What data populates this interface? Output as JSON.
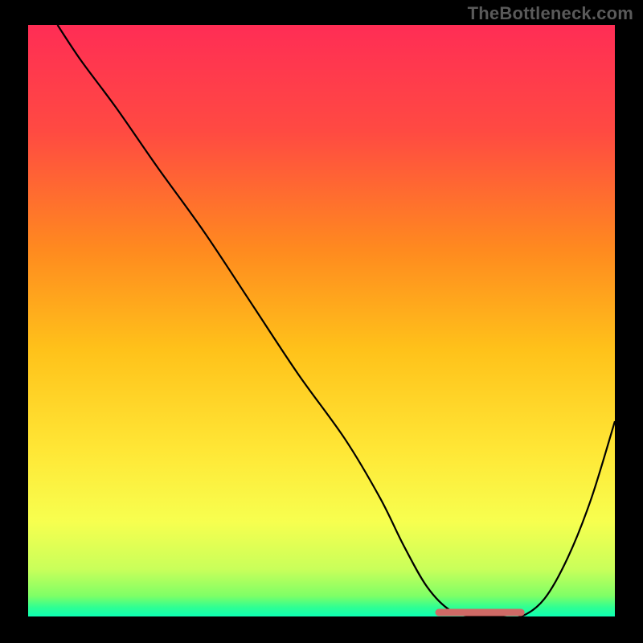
{
  "watermark": "TheBottleneck.com",
  "colors": {
    "background": "#000000",
    "curve": "#000000",
    "marker": "#cf6a66",
    "gradient_stops": [
      {
        "offset": 0.0,
        "color": "#ff2d55"
      },
      {
        "offset": 0.18,
        "color": "#ff4a42"
      },
      {
        "offset": 0.38,
        "color": "#ff8a1f"
      },
      {
        "offset": 0.55,
        "color": "#ffc21a"
      },
      {
        "offset": 0.72,
        "color": "#ffe736"
      },
      {
        "offset": 0.84,
        "color": "#f7ff4f"
      },
      {
        "offset": 0.92,
        "color": "#c9ff5a"
      },
      {
        "offset": 0.965,
        "color": "#7fff66"
      },
      {
        "offset": 0.985,
        "color": "#2dff94"
      },
      {
        "offset": 1.0,
        "color": "#0dffb3"
      }
    ]
  },
  "chart_data": {
    "type": "line",
    "title": "",
    "xlabel": "",
    "ylabel": "",
    "xlim": [
      0,
      100
    ],
    "ylim": [
      0,
      100
    ],
    "series": [
      {
        "name": "bottleneck-curve",
        "x": [
          5,
          9,
          15,
          22,
          30,
          38,
          46,
          54,
          60,
          64,
          68,
          72,
          76,
          80,
          84,
          88,
          92,
          96,
          100
        ],
        "y": [
          100,
          94,
          86,
          76,
          65,
          53,
          41,
          30,
          20,
          12,
          5,
          1,
          0,
          0,
          0,
          3,
          10,
          20,
          33
        ]
      }
    ],
    "marker_band": {
      "name": "optimal-range",
      "x": [
        70,
        84
      ],
      "y": [
        0,
        0
      ]
    }
  }
}
